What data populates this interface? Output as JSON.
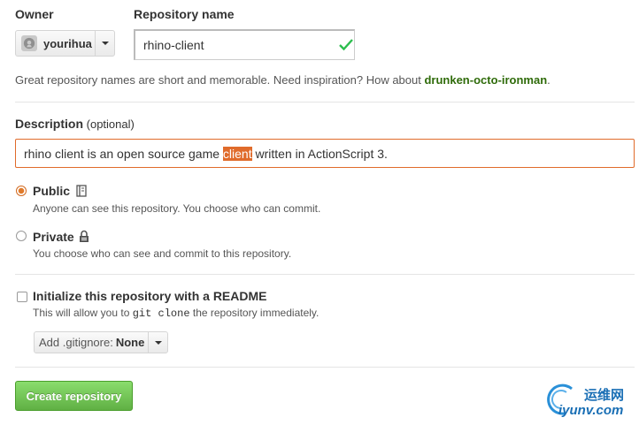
{
  "owner": {
    "label": "Owner",
    "selected": "yourihua"
  },
  "repository": {
    "label": "Repository name",
    "value": "rhino-client"
  },
  "hint": {
    "text": "Great repository names are short and memorable. Need inspiration? How about ",
    "suggestion": "drunken-octo-ironman",
    "suffix": "."
  },
  "description": {
    "label": "Description",
    "optional": "(optional)",
    "value_before": "rhino client is an open source game ",
    "value_highlight": "client",
    "value_after": " written in ActionScript 3."
  },
  "visibility": {
    "public": {
      "label": "Public",
      "help": "Anyone can see this repository. You choose who can commit.",
      "selected": true
    },
    "private": {
      "label": "Private",
      "help": "You choose who can see and commit to this repository.",
      "selected": false
    }
  },
  "readme": {
    "label": "Initialize this repository with a README",
    "help_before": "This will allow you to ",
    "help_code": "git clone",
    "help_after": " the repository immediately.",
    "checked": false
  },
  "gitignore": {
    "prefix": "Add .gitignore:",
    "value": "None"
  },
  "submit": {
    "label": "Create repository"
  },
  "watermark": {
    "cn": "运维网",
    "url": "iyunv.com"
  },
  "colors": {
    "accent_orange": "#e06b2b",
    "success_green": "#60b044",
    "suggestion_green": "#2f6b0a"
  },
  "icons": {
    "owner_avatar": "octocat-avatar-icon",
    "valid": "check-icon",
    "public": "book-icon",
    "private": "lock-icon"
  }
}
